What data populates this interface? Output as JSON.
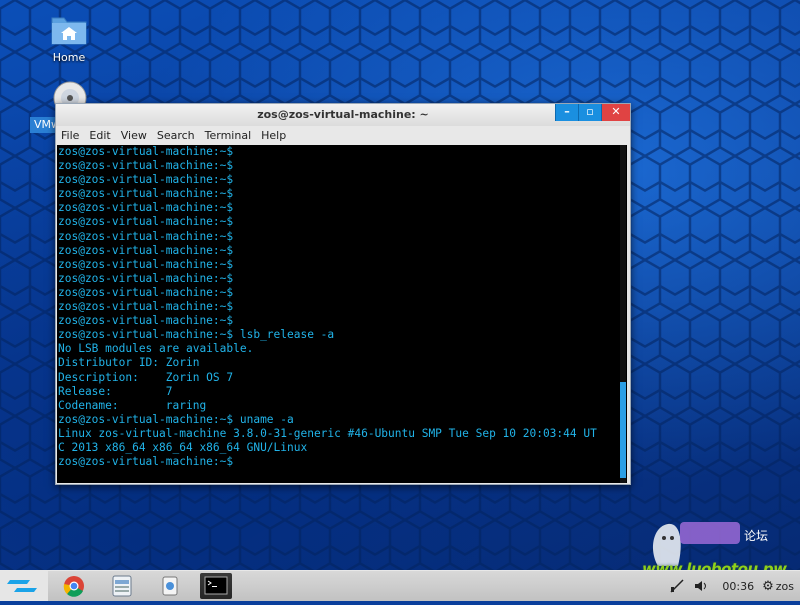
{
  "desktop": {
    "icons": [
      {
        "label": "Home",
        "icon": "folder-home-icon"
      },
      {
        "label": "VMw",
        "icon": "disc-icon"
      }
    ]
  },
  "window": {
    "title": "zos@zos-virtual-machine: ~",
    "controls": {
      "minimize": "–",
      "maximize": "▫",
      "close": "✕"
    },
    "menu": [
      "File",
      "Edit",
      "View",
      "Search",
      "Terminal",
      "Help"
    ]
  },
  "terminal": {
    "lines": [
      "zos@zos-virtual-machine:~$",
      "zos@zos-virtual-machine:~$",
      "zos@zos-virtual-machine:~$",
      "zos@zos-virtual-machine:~$",
      "zos@zos-virtual-machine:~$",
      "zos@zos-virtual-machine:~$",
      "zos@zos-virtual-machine:~$",
      "zos@zos-virtual-machine:~$",
      "zos@zos-virtual-machine:~$",
      "zos@zos-virtual-machine:~$",
      "zos@zos-virtual-machine:~$",
      "zos@zos-virtual-machine:~$",
      "zos@zos-virtual-machine:~$",
      "zos@zos-virtual-machine:~$ lsb_release -a",
      "No LSB modules are available.",
      "Distributor ID: Zorin",
      "Description:    Zorin OS 7",
      "Release:        7",
      "Codename:       raring",
      "zos@zos-virtual-machine:~$ uname -a",
      "Linux zos-virtual-machine 3.8.0-31-generic #46-Ubuntu SMP Tue Sep 10 20:03:44 UT",
      "C 2013 x86_64 x86_64 x86_64 GNU/Linux",
      "zos@zos-virtual-machine:~$"
    ]
  },
  "taskbar": {
    "apps": [
      "zorin-menu-icon",
      "chrome-icon",
      "file-manager-icon",
      "disc-app-icon",
      "terminal-icon"
    ],
    "clock": "00:36",
    "user": "zos"
  },
  "watermark": {
    "text": "www.luobotou.pw",
    "logo_text": "论坛"
  }
}
